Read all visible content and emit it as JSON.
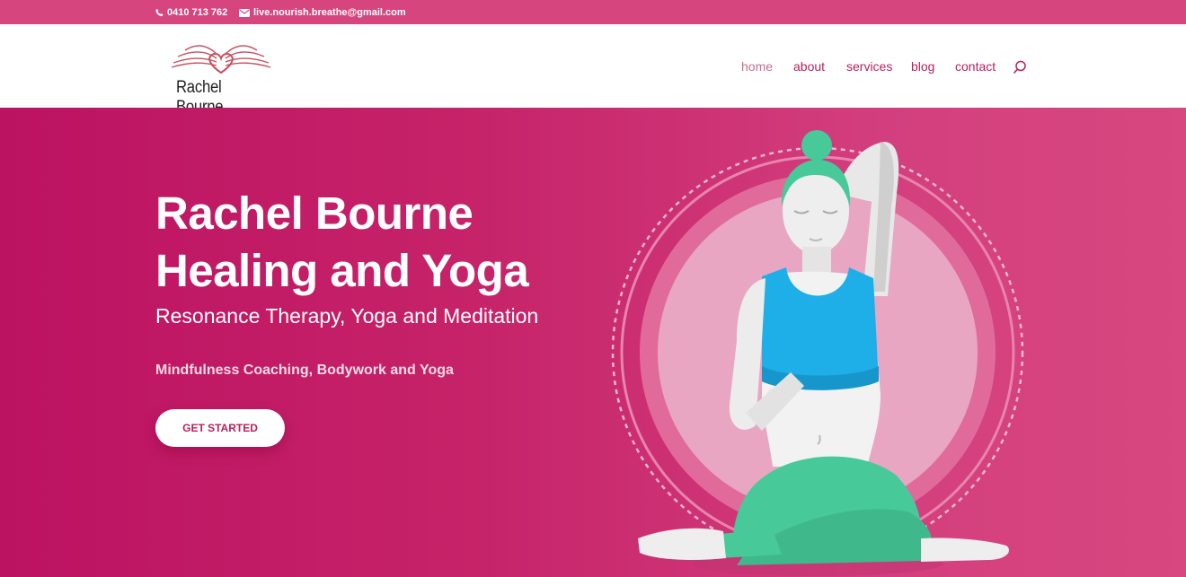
{
  "topbar": {
    "phone": "0410 713 762",
    "email": "live.nourish.breathe@gmail.com",
    "phone_icon": "phone-icon",
    "email_icon": "envelope-icon"
  },
  "logo": {
    "text": "Rachel Bourne"
  },
  "nav": {
    "items": [
      {
        "label": "home"
      },
      {
        "label": "about"
      },
      {
        "label": "services"
      },
      {
        "label": "blog"
      },
      {
        "label": "contact"
      }
    ],
    "search_icon": "search-icon"
  },
  "hero": {
    "title_line1": "Rachel Bourne",
    "title_line2": "Healing and Yoga",
    "subtitle": "Resonance Therapy, Yoga and Meditation",
    "tagline": "Mindfulness Coaching, Bodywork and Yoga",
    "cta_label": "GET STARTED"
  },
  "colors": {
    "accent": "#d6457e",
    "hero_dark": "#bc1262",
    "hero_light": "#d8477f",
    "nav_text": "#b8205c",
    "top_green": "#47c99a",
    "top_blue": "#1eaee8"
  }
}
